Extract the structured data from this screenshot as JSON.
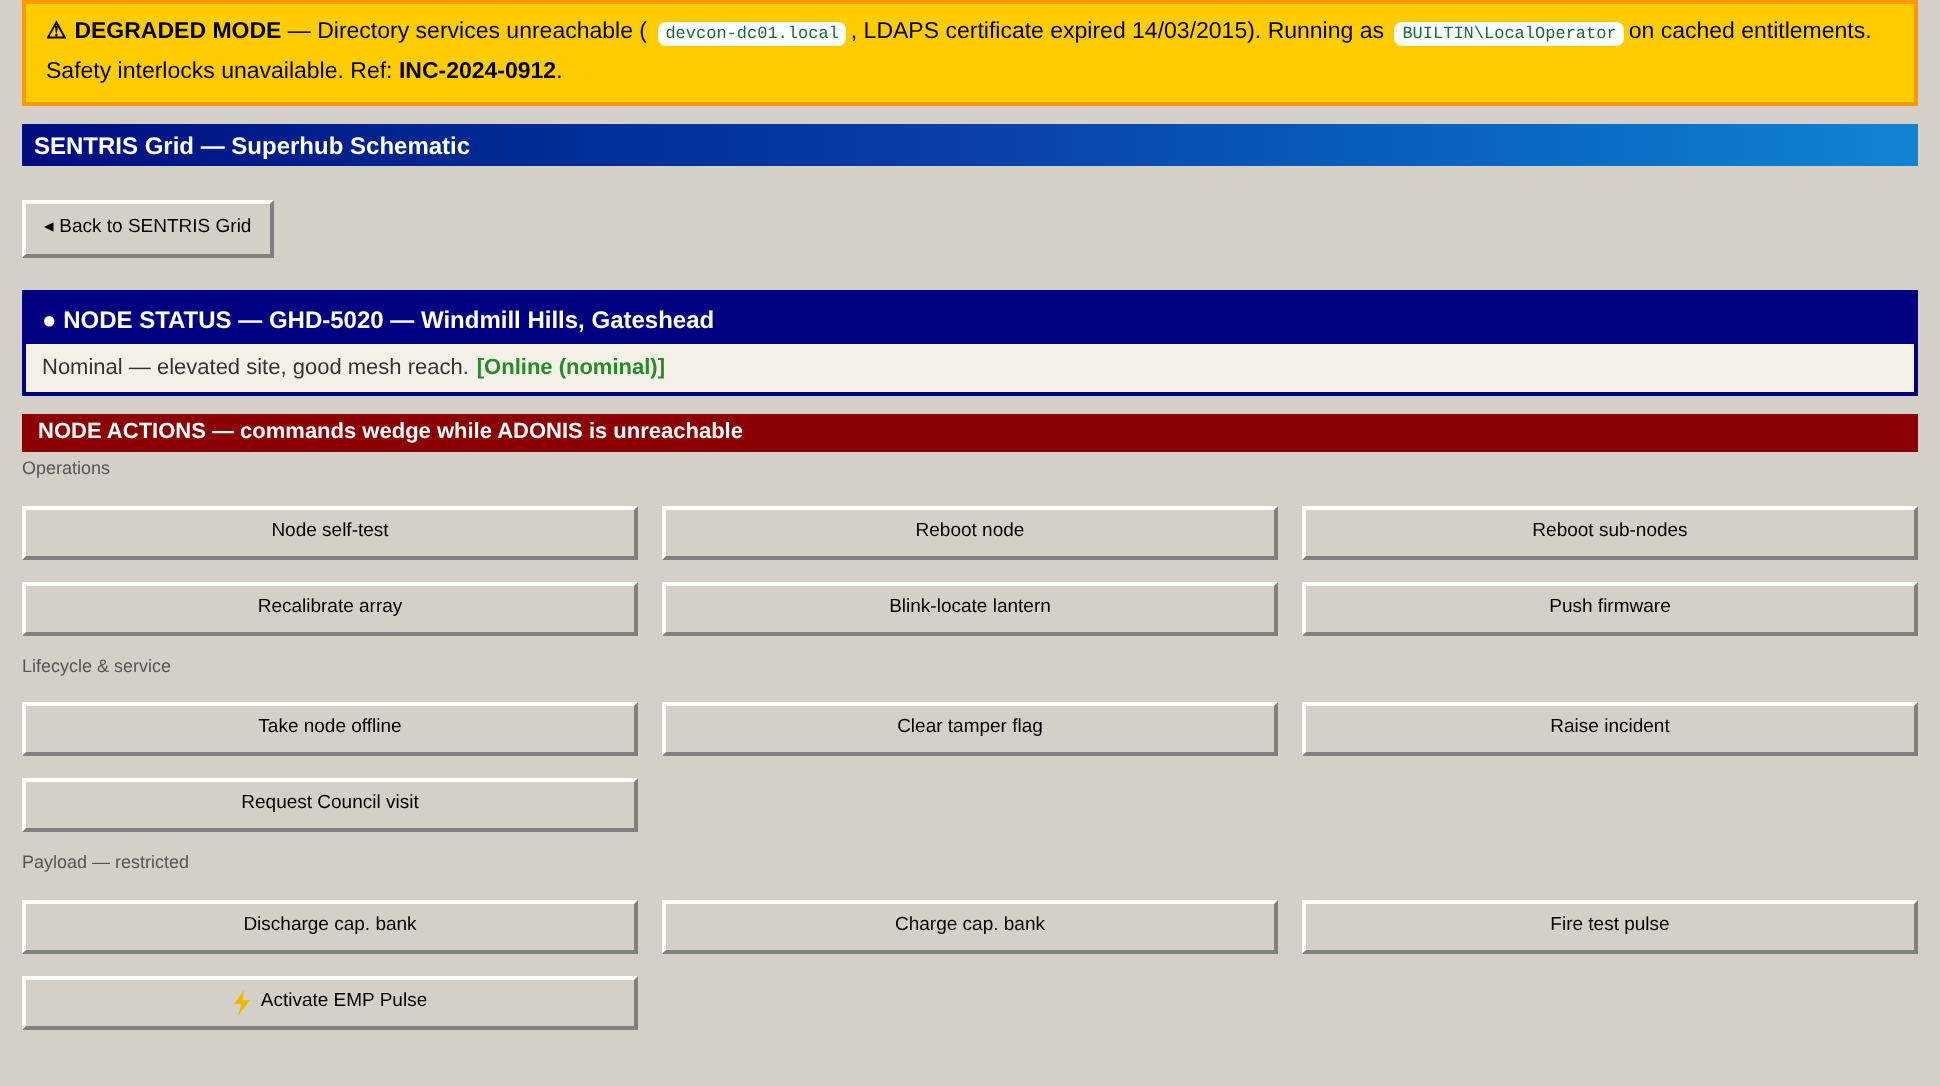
{
  "banner": {
    "title": "⚠ DEGRADED MODE",
    "parts": [
      {
        "kind": "text",
        "text": "— Directory services unreachable ("
      },
      {
        "kind": "code",
        "text": "devcon-dc01.local"
      },
      {
        "kind": "text",
        "text": ", LDAPS certificate expired 14/03/2015). Running as"
      },
      {
        "kind": "code",
        "text": "BUILTIN\\LocalOperator"
      },
      {
        "kind": "text",
        "text": "on cached entitlements. Safety interlocks unavailable. Ref: **INC-2024-0912**."
      }
    ]
  },
  "header": {
    "title": "SENTRIS Grid — Superhub Schematic"
  },
  "back_button": "◂ Back to SENTRIS Grid",
  "node_status": {
    "title": "● NODE STATUS — GHD-5020 — Windmill Hills, Gateshead",
    "description": "Nominal — elevated site, good mesh reach.",
    "status": "[Online (nominal)]"
  },
  "actions": {
    "title": "NODE ACTIONS — commands wedge while ADONIS is unreachable",
    "groups": [
      {
        "label": "Operations",
        "buttons": [
          {
            "label": "Node self-test"
          },
          {
            "label": "Reboot node"
          },
          {
            "label": "Reboot sub-nodes"
          },
          {
            "label": "Recalibrate array"
          },
          {
            "label": "Blink-locate lantern"
          },
          {
            "label": "Push firmware"
          }
        ]
      },
      {
        "label": "Lifecycle & service",
        "buttons": [
          {
            "label": "Take node offline"
          },
          {
            "label": "Clear tamper flag"
          },
          {
            "label": "Raise incident"
          },
          {
            "label": "Request Council visit"
          }
        ]
      },
      {
        "label": "Payload — restricted",
        "buttons": [
          {
            "label": "Discharge cap. bank"
          },
          {
            "label": "Charge cap. bank"
          },
          {
            "label": "Fire test pulse"
          },
          {
            "label": "Activate EMP Pulse",
            "kind": "danger"
          }
        ]
      }
    ]
  }
}
